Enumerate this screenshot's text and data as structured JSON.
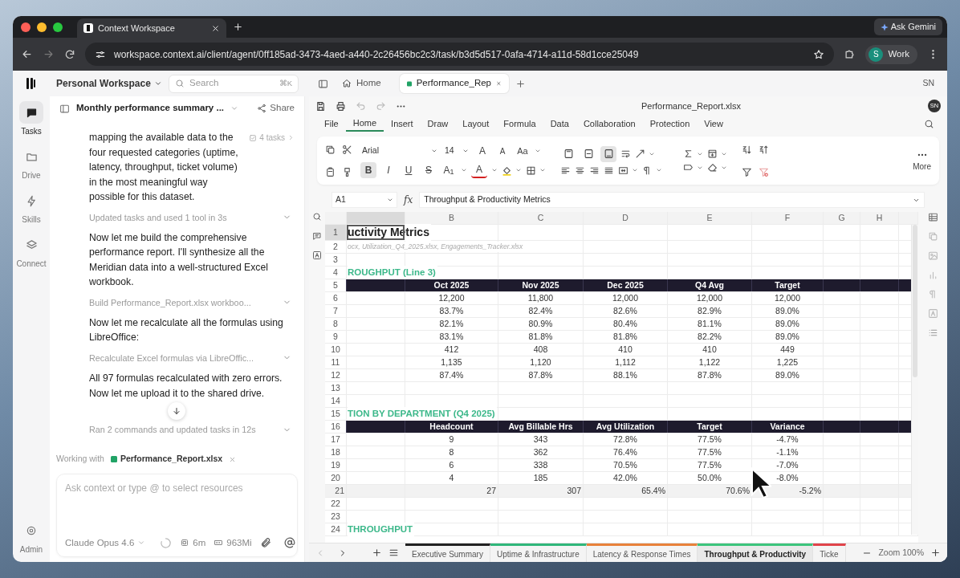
{
  "browser": {
    "tab_title": "Context Workspace",
    "ask": "Ask Gemini",
    "url": "workspace.context.ai/client/agent/0ff185ad-3473-4aed-a440-2c26456bc2c3/task/b3d5d517-0afa-4714-a11d-58d1cce25049",
    "profile_initial": "S",
    "profile": "Work"
  },
  "topbar": {
    "workspace": "Personal Workspace",
    "search_placeholder": "Search",
    "search_shortcut": "⌘K",
    "user": "SN",
    "tabs": [
      {
        "label": "Home",
        "kind": "home",
        "selected": false
      },
      {
        "label": "Performance_Rep",
        "kind": "file",
        "selected": true
      }
    ]
  },
  "rail": [
    {
      "label": "Tasks",
      "kind": "tasks",
      "selected": true
    },
    {
      "label": "Drive",
      "kind": "drive",
      "selected": false
    },
    {
      "label": "Skills",
      "kind": "skills",
      "selected": false
    },
    {
      "label": "Connect",
      "kind": "connect",
      "selected": false
    }
  ],
  "rail_bottom": {
    "label": "Admin"
  },
  "chat": {
    "title": "Monthly performance summary ...",
    "share": "Share",
    "tasks_badge": "4 tasks",
    "messages": [
      {
        "kind": "text",
        "text": "mapping the available data to the four requested categories (uptime, latency, throughput, ticket volume) in the most meaningful way possible for this dataset."
      },
      {
        "kind": "step",
        "text": "Updated tasks and used 1 tool in 3s"
      },
      {
        "kind": "text",
        "text": "Now let me build the comprehensive performance report. I'll synthesize all the Meridian data into a well-structured Excel workbook."
      },
      {
        "kind": "step",
        "text": "Build Performance_Report.xlsx workboo..."
      },
      {
        "kind": "text",
        "text": "Now let me recalculate all the formulas using LibreOffice:"
      },
      {
        "kind": "step",
        "text": "Recalculate Excel formulas via LibreOffic..."
      },
      {
        "kind": "text",
        "text": "All 97 formulas recalculated with zero errors. Now let me upload it to the shared drive."
      },
      {
        "kind": "step",
        "text": "Ran 2 commands and updated tasks in 12s"
      }
    ],
    "working_with": "Working with",
    "file": "Performance_Report.xlsx",
    "input_placeholder": "Ask context or type @ to select resources",
    "model": "Claude Opus 4.6",
    "time": "6m",
    "memory": "963Mi"
  },
  "sheet": {
    "title": "Performance_Report.xlsx",
    "user": "SN",
    "menu": [
      {
        "label": "File",
        "selected": false
      },
      {
        "label": "Home",
        "selected": true
      },
      {
        "label": "Insert",
        "selected": false
      },
      {
        "label": "Draw",
        "selected": false
      },
      {
        "label": "Layout",
        "selected": false
      },
      {
        "label": "Formula",
        "selected": false
      },
      {
        "label": "Data",
        "selected": false
      },
      {
        "label": "Collaboration",
        "selected": false
      },
      {
        "label": "Protection",
        "selected": false
      },
      {
        "label": "View",
        "selected": false
      }
    ],
    "ribbon": {
      "font": "Arial",
      "font_size": "14",
      "more": "More",
      "font_tools": [
        {
          "label": "A",
          "kind": "grow"
        },
        {
          "label": "A",
          "kind": "shrink"
        },
        {
          "label": "Aa",
          "kind": "case"
        }
      ],
      "format": [
        {
          "label": "B",
          "kind": "bold",
          "selected": true
        },
        {
          "label": "I",
          "kind": "italic",
          "selected": false
        },
        {
          "label": "U",
          "kind": "underline",
          "selected": false
        },
        {
          "label": "S",
          "kind": "strike",
          "selected": false
        },
        {
          "label": "A$_{1}$",
          "kind": "script",
          "selected": false
        },
        {
          "label": "A",
          "kind": "color",
          "selected": false
        }
      ],
      "valign": [
        {
          "kind": "top",
          "selected": false
        },
        {
          "kind": "middle",
          "selected": false
        },
        {
          "kind": "bottom",
          "selected": true
        }
      ]
    },
    "cell_ref": "A1",
    "fx": "fx",
    "formula": "Throughput & Productivity Metrics",
    "columns": [
      {
        "selected": true
      },
      {
        "label": "B",
        "selected": false
      },
      {
        "label": "C",
        "selected": false
      },
      {
        "label": "D",
        "selected": false
      },
      {
        "label": "E",
        "selected": false
      },
      {
        "label": "F",
        "selected": false
      },
      {
        "label": "G",
        "selected": false
      },
      {
        "label": "H",
        "selected": false
      }
    ],
    "rows": [
      {
        "num": "1",
        "kind": "title",
        "selected": true,
        "cells": [
          "uctivity Metrics"
        ]
      },
      {
        "num": "2",
        "kind": "source",
        "selected": false,
        "cells": [
          "ocx, Utilization_Q4_2025.xlsx, Engagements_Tracker.xlsx"
        ]
      },
      {
        "num": "3",
        "kind": "blank",
        "selected": false,
        "cells": []
      },
      {
        "num": "4",
        "kind": "section",
        "selected": false,
        "cells": [
          "ROUGHPUT (Line 3)"
        ]
      },
      {
        "num": "5",
        "kind": "header",
        "selected": false,
        "cells": [
          null,
          "Oct 2025",
          "Nov 2025",
          "Dec 2025",
          "Q4 Avg",
          "Target"
        ]
      },
      {
        "num": "6",
        "kind": "data",
        "selected": false,
        "cells": [
          null,
          "12,200",
          "11,800",
          "12,000",
          "12,000",
          "12,000"
        ]
      },
      {
        "num": "7",
        "kind": "data",
        "selected": false,
        "cells": [
          null,
          "83.7%",
          "82.4%",
          "82.6%",
          "82.9%",
          "89.0%"
        ]
      },
      {
        "num": "8",
        "kind": "data",
        "selected": false,
        "cells": [
          null,
          "82.1%",
          "80.9%",
          "80.4%",
          "81.1%",
          "89.0%"
        ]
      },
      {
        "num": "9",
        "kind": "data",
        "selected": false,
        "cells": [
          null,
          "83.1%",
          "81.8%",
          "81.8%",
          "82.2%",
          "89.0%"
        ]
      },
      {
        "num": "10",
        "kind": "data",
        "selected": false,
        "cells": [
          null,
          "412",
          "408",
          "410",
          "410",
          "449"
        ]
      },
      {
        "num": "11",
        "kind": "data",
        "selected": false,
        "cells": [
          null,
          "1,135",
          "1,120",
          "1,112",
          "1,122",
          "1,225"
        ]
      },
      {
        "num": "12",
        "kind": "data",
        "selected": false,
        "cells": [
          null,
          "87.4%",
          "87.8%",
          "88.1%",
          "87.8%",
          "89.0%"
        ]
      },
      {
        "num": "13",
        "kind": "blank",
        "selected": false,
        "cells": []
      },
      {
        "num": "14",
        "kind": "blank",
        "selected": false,
        "cells": []
      },
      {
        "num": "15",
        "kind": "section",
        "selected": false,
        "cells": [
          "TION BY DEPARTMENT (Q4 2025)"
        ]
      },
      {
        "num": "16",
        "kind": "header",
        "selected": false,
        "cells": [
          null,
          "Headcount",
          "Avg Billable Hrs",
          "Avg Utilization",
          "Target",
          "Variance"
        ]
      },
      {
        "num": "17",
        "kind": "data",
        "selected": false,
        "cells": [
          null,
          "9",
          "343",
          "72.8%",
          "77.5%",
          "-4.7%"
        ]
      },
      {
        "num": "18",
        "kind": "data",
        "selected": false,
        "cells": [
          null,
          "8",
          "362",
          "76.4%",
          "77.5%",
          "-1.1%"
        ]
      },
      {
        "num": "19",
        "kind": "data",
        "selected": false,
        "cells": [
          null,
          "6",
          "338",
          "70.5%",
          "77.5%",
          "-7.0%"
        ]
      },
      {
        "num": "20",
        "kind": "data",
        "selected": false,
        "cells": [
          null,
          "4",
          "185",
          "42.0%",
          "50.0%",
          "-8.0%"
        ]
      },
      {
        "num": "21",
        "kind": "total",
        "selected": false,
        "cells": [
          null,
          "27",
          "307",
          "65.4%",
          "70.6%",
          "-5.2%"
        ]
      },
      {
        "num": "22",
        "kind": "blank",
        "selected": false,
        "cells": []
      },
      {
        "num": "23",
        "kind": "blank",
        "selected": false,
        "cells": []
      },
      {
        "num": "24",
        "kind": "section",
        "selected": false,
        "cells": [
          "THROUGHPUT"
        ]
      }
    ],
    "sheet_tabs": [
      {
        "label": "Executive Summary",
        "color": "#222222",
        "selected": false
      },
      {
        "label": "Uptime & Infrastructure",
        "color": "#2fb67a",
        "selected": false
      },
      {
        "label": "Latency & Response Times",
        "color": "#e8813a",
        "selected": false
      },
      {
        "label": "Throughput & Productivity",
        "color": "#3cc47c",
        "selected": true
      },
      {
        "label": "Ticke",
        "color": "#e0444a",
        "selected": false
      }
    ],
    "zoom": "Zoom 100%"
  }
}
